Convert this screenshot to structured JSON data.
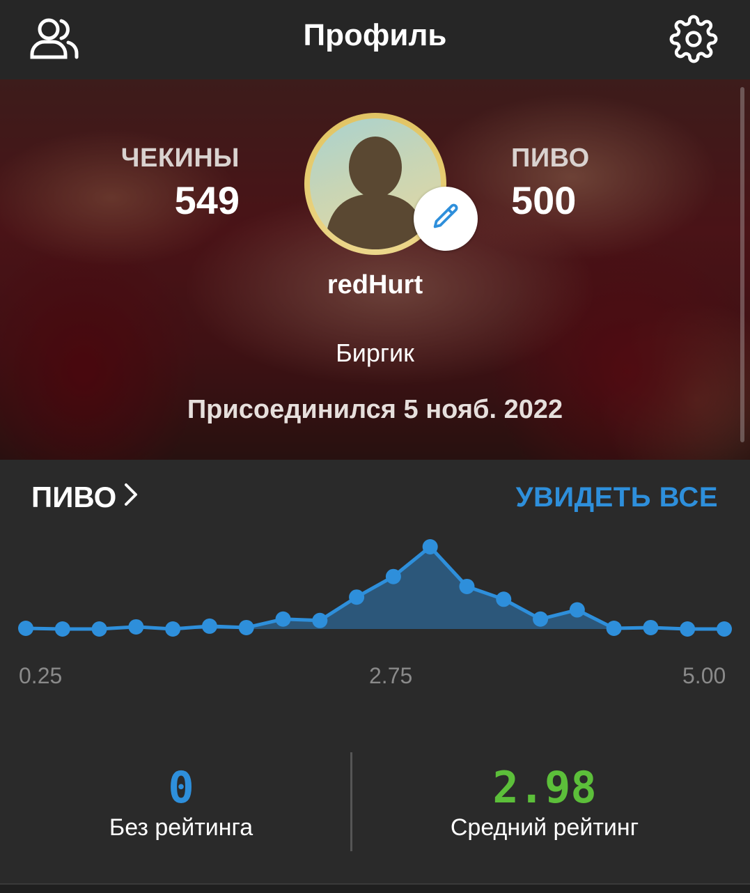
{
  "header": {
    "title": "Профиль",
    "left_icon": "users-icon",
    "right_icon": "gear-icon"
  },
  "profile": {
    "checkins_label": "ЧЕКИНЫ",
    "checkins_value": "549",
    "beer_label": "ПИВО",
    "beer_value": "500",
    "username": "redHurt",
    "role": "Биргик",
    "joined": "Присоединился 5 нояб. 2022",
    "avatar_icon": "default-avatar-icon",
    "edit_icon": "pencil-icon"
  },
  "beer_section": {
    "title": "ПИВО",
    "see_all": "УВИДЕТЬ ВСЕ"
  },
  "chart_data": {
    "type": "area",
    "x": [
      0.25,
      0.5,
      0.75,
      1.0,
      1.25,
      1.5,
      1.75,
      2.0,
      2.25,
      2.5,
      2.75,
      3.0,
      3.25,
      3.5,
      3.75,
      4.0,
      4.25,
      4.5,
      4.75,
      5.0
    ],
    "values": [
      1,
      0,
      0,
      3,
      0,
      4,
      2,
      14,
      12,
      45,
      74,
      116,
      60,
      42,
      14,
      27,
      1,
      2,
      0,
      0
    ],
    "xticks": [
      "0.25",
      "2.75",
      "5.00"
    ],
    "color": "#2e8fdb"
  },
  "stats": {
    "unrated_value": "0",
    "unrated_label": "Без рейтинга",
    "avg_value": "2.98",
    "avg_label": "Средний рейтинг",
    "unrated_color": "#2e8fdb",
    "avg_color": "#5cbf3a"
  }
}
